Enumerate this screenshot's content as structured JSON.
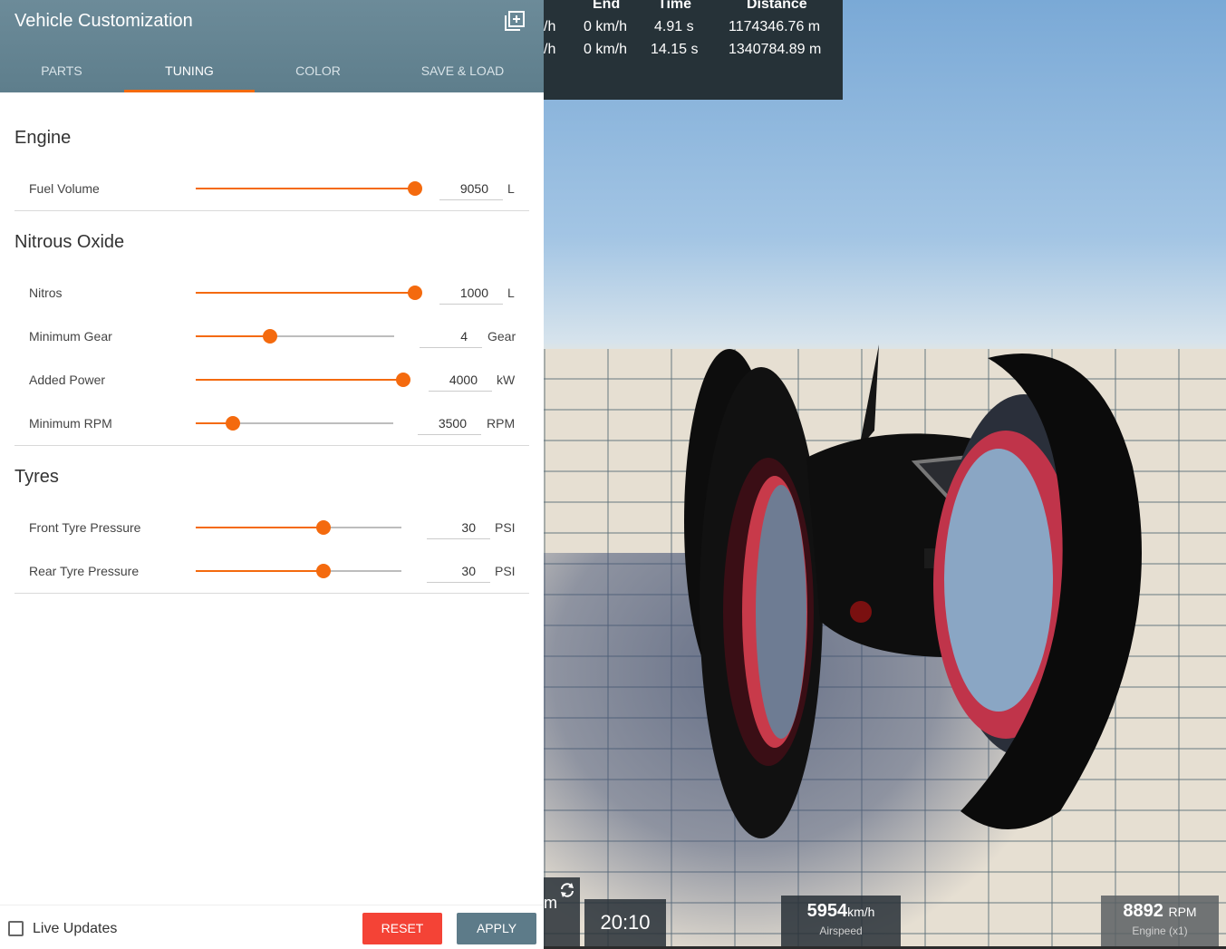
{
  "panel": {
    "title": "Vehicle Customization",
    "tabs": [
      {
        "label": "PARTS"
      },
      {
        "label": "TUNING"
      },
      {
        "label": "COLOR"
      },
      {
        "label": "SAVE & LOAD"
      }
    ],
    "active_tab": "TUNING",
    "accent_color": "#f46a0e",
    "sections": [
      {
        "title": "Engine",
        "rows": [
          {
            "label": "Fuel Volume",
            "value": "9050",
            "unit": "L",
            "fraction": 1.0
          }
        ]
      },
      {
        "title": "Nitrous Oxide",
        "rows": [
          {
            "label": "Nitros",
            "value": "1000",
            "unit": "L",
            "fraction": 1.0
          },
          {
            "label": "Minimum Gear",
            "value": "4",
            "unit": "Gear",
            "fraction": 0.375
          },
          {
            "label": "Added Power",
            "value": "4000",
            "unit": "kW",
            "fraction": 1.0
          },
          {
            "label": "Minimum RPM",
            "value": "3500",
            "unit": "RPM",
            "fraction": 0.19
          }
        ]
      },
      {
        "title": "Tyres",
        "rows": [
          {
            "label": "Front Tyre Pressure",
            "value": "30",
            "unit": "PSI",
            "fraction": 0.62
          },
          {
            "label": "Rear Tyre Pressure",
            "value": "30",
            "unit": "PSI",
            "fraction": 0.62
          }
        ]
      }
    ],
    "footer": {
      "live_updates_label": "Live Updates",
      "live_updates_checked": false,
      "reset_label": "RESET",
      "apply_label": "APPLY"
    }
  },
  "race_table": {
    "headers": [
      "End",
      "Time",
      "Distance"
    ],
    "rows": [
      {
        "prefix": "/h",
        "end": "0 km/h",
        "time": "4.91 s",
        "distance": "1174346.76 m"
      },
      {
        "prefix": "/h",
        "end": "0 km/h",
        "time": "14.15 s",
        "distance": "1340784.89 m"
      }
    ]
  },
  "hud": {
    "partial_left_text": "m",
    "clock": "20:10",
    "speed_value": "5954",
    "speed_unit": "km/h",
    "speed_label": "Airspeed",
    "rpm_value": "8892",
    "rpm_unit": "RPM",
    "rpm_label": "Engine (x1)"
  }
}
